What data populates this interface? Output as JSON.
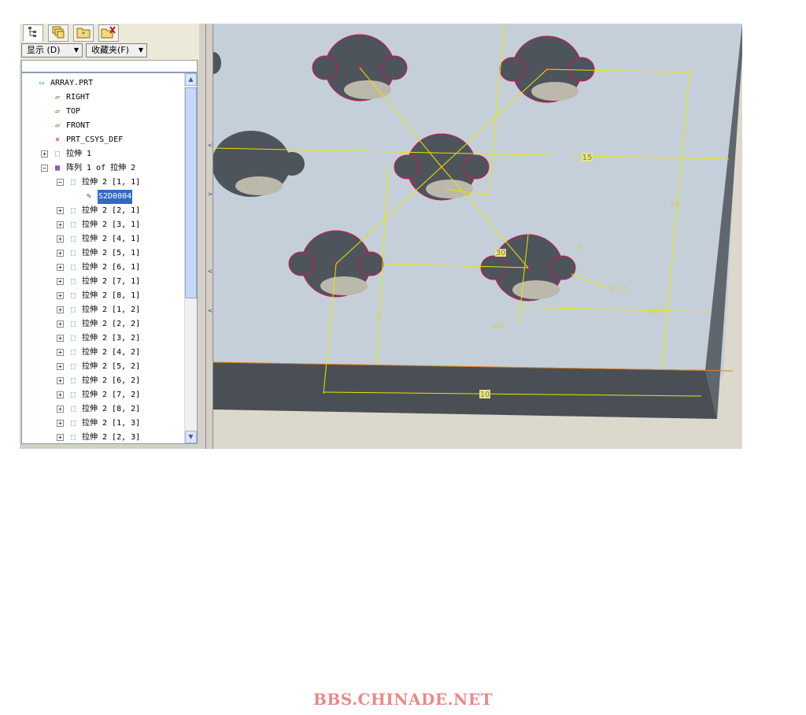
{
  "toolbar": {
    "tabs": [
      "model-tree-tab",
      "layers-tab",
      "folder-browser-tab",
      "favorites-tab"
    ],
    "show_label": "显示 (D)",
    "favorites_label": "收藏夹(F)"
  },
  "tree": {
    "items": [
      {
        "label": "ARRAY.PRT",
        "icon": "part-icon",
        "indent": 0,
        "expander": ""
      },
      {
        "label": "RIGHT",
        "icon": "datum-plane-icon",
        "indent": 1,
        "expander": ""
      },
      {
        "label": "TOP",
        "icon": "datum-plane-icon",
        "indent": 1,
        "expander": ""
      },
      {
        "label": "FRONT",
        "icon": "datum-plane-icon",
        "indent": 1,
        "expander": ""
      },
      {
        "label": "PRT_CSYS_DEF",
        "icon": "csys-icon",
        "indent": 1,
        "expander": ""
      },
      {
        "label": "拉伸 1",
        "icon": "extrude-icon",
        "indent": 1,
        "expander": "+"
      },
      {
        "label": "阵列 1 of 拉伸 2",
        "icon": "pattern-icon",
        "indent": 1,
        "expander": "-"
      },
      {
        "label": "拉伸 2 [1, 1]",
        "icon": "extrude-icon",
        "indent": 2,
        "expander": "-"
      },
      {
        "label": "S2D0004",
        "icon": "sketch-icon",
        "indent": 3,
        "expander": "",
        "selected": true
      },
      {
        "label": "拉伸 2 [2, 1]",
        "icon": "extrude-icon",
        "indent": 2,
        "expander": "+"
      },
      {
        "label": "拉伸 2 [3, 1]",
        "icon": "extrude-icon",
        "indent": 2,
        "expander": "+"
      },
      {
        "label": "拉伸 2 [4, 1]",
        "icon": "extrude-icon",
        "indent": 2,
        "expander": "+"
      },
      {
        "label": "拉伸 2 [5, 1]",
        "icon": "extrude-icon",
        "indent": 2,
        "expander": "+"
      },
      {
        "label": "拉伸 2 [6, 1]",
        "icon": "extrude-icon",
        "indent": 2,
        "expander": "+"
      },
      {
        "label": "拉伸 2 [7, 1]",
        "icon": "extrude-icon",
        "indent": 2,
        "expander": "+"
      },
      {
        "label": "拉伸 2 [8, 1]",
        "icon": "extrude-icon",
        "indent": 2,
        "expander": "+"
      },
      {
        "label": "拉伸 2 [1, 2]",
        "icon": "extrude-icon",
        "indent": 2,
        "expander": "+"
      },
      {
        "label": "拉伸 2 [2, 2]",
        "icon": "extrude-icon",
        "indent": 2,
        "expander": "+"
      },
      {
        "label": "拉伸 2 [3, 2]",
        "icon": "extrude-icon",
        "indent": 2,
        "expander": "+"
      },
      {
        "label": "拉伸 2 [4, 2]",
        "icon": "extrude-icon",
        "indent": 2,
        "expander": "+"
      },
      {
        "label": "拉伸 2 [5, 2]",
        "icon": "extrude-icon",
        "indent": 2,
        "expander": "+"
      },
      {
        "label": "拉伸 2 [6, 2]",
        "icon": "extrude-icon",
        "indent": 2,
        "expander": "+"
      },
      {
        "label": "拉伸 2 [7, 2]",
        "icon": "extrude-icon",
        "indent": 2,
        "expander": "+"
      },
      {
        "label": "拉伸 2 [8, 2]",
        "icon": "extrude-icon",
        "indent": 2,
        "expander": "+"
      },
      {
        "label": "拉伸 2 [1, 3]",
        "icon": "extrude-icon",
        "indent": 2,
        "expander": "+"
      },
      {
        "label": "拉伸 2 [2, 3]",
        "icon": "extrude-icon",
        "indent": 2,
        "expander": "+"
      }
    ]
  },
  "viewport": {
    "dimensions": {
      "d15": "15",
      "d18": "18",
      "d8": "8",
      "d10": "10",
      "d6": "6",
      "d10b": "10",
      "dia25": "Ø1.5",
      "dia4": "Ø4",
      "d30": "30"
    },
    "colors": {
      "plate_top": "#c8d0da",
      "plate_side": "#4a4f55",
      "hole_edge": "#d4145a",
      "dim_line": "#e6e600",
      "background": "#dcd8cc"
    }
  },
  "watermark": "BBS.CHINADE.NET"
}
